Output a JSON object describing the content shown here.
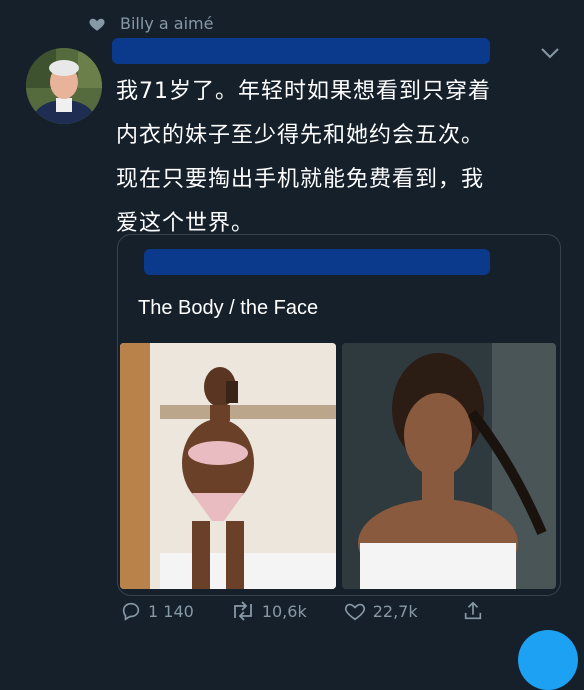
{
  "context": {
    "label": "Billy a aimé"
  },
  "tweet": {
    "lines": [
      "我71岁了。年轻时如果想看到只穿着",
      "内衣的妹子至少得先和她约会五次。",
      "现在只要掏出手机就能免费看到，我",
      "爱这个世界。"
    ]
  },
  "quoted": {
    "title": "The Body / the Face"
  },
  "actions": {
    "replies": "1 140",
    "retweets": "10,6k",
    "likes": "22,7k"
  },
  "colors": {
    "background": "#15202b",
    "muted": "#8899a6",
    "accent": "#1da1f2",
    "redaction": "#0b3a8c"
  }
}
